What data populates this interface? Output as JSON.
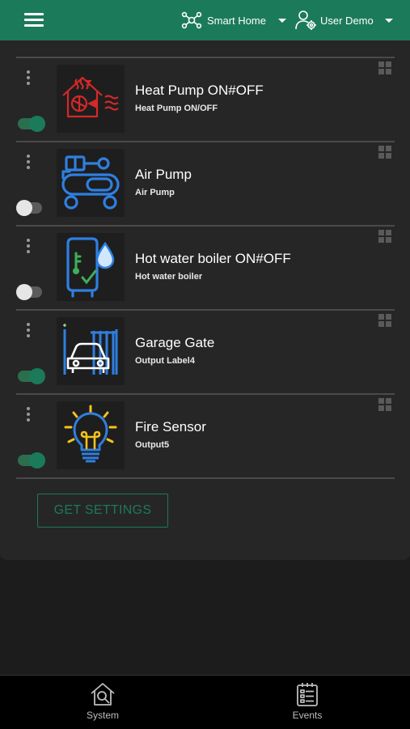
{
  "header": {
    "menu_icon": "hamburger-menu-icon",
    "site_icon": "network-hub-icon",
    "site_name": "Smart Home",
    "user_icon": "user-gear-icon",
    "user_name": "User Demo",
    "accent_color": "#1b7a5a"
  },
  "outputs": [
    {
      "title": "Heat Pump ON#OFF",
      "subtitle": "Heat Pump ON/OFF",
      "icon": "heat-pump-house-icon",
      "state": "on"
    },
    {
      "title": "Air Pump",
      "subtitle": "Air Pump",
      "icon": "air-compressor-icon",
      "state": "off"
    },
    {
      "title": "Hot water boiler ON#OFF",
      "subtitle": "Hot water boiler",
      "icon": "water-boiler-icon",
      "state": "off"
    },
    {
      "title": "Garage Gate",
      "subtitle": "Output Label4",
      "icon": "garage-gate-car-icon",
      "state": "on"
    },
    {
      "title": "Fire Sensor",
      "subtitle": "Output5",
      "icon": "light-bulb-icon",
      "state": "on"
    }
  ],
  "actions": {
    "get_settings_label": "GET SETTINGS"
  },
  "bottom_nav": [
    {
      "label": "System",
      "icon": "house-search-icon"
    },
    {
      "label": "Events",
      "icon": "event-list-icon"
    }
  ]
}
